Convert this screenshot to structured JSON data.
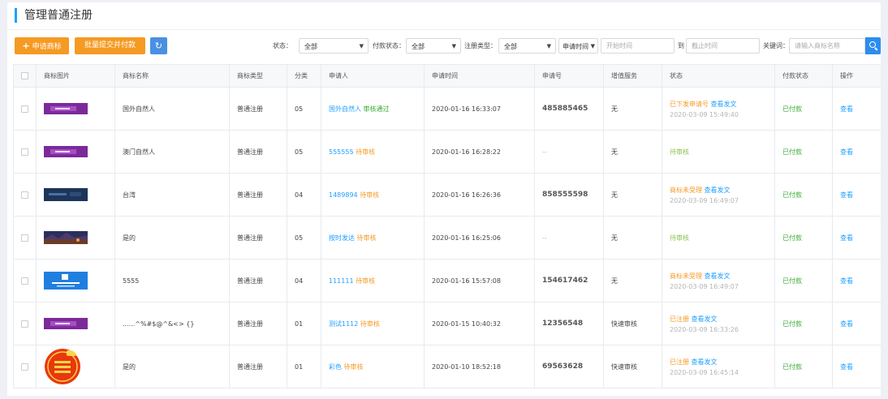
{
  "page": {
    "title": "管理普通注册"
  },
  "toolbar": {
    "apply_label": "申请商标",
    "batch_label": "批量提交并付款",
    "refresh_icon": "refresh-icon",
    "status_label": "状态：",
    "status_value": "全部",
    "pay_status_label": "付款状态：",
    "pay_status_value": "全部",
    "reg_type_label": "注册类型：",
    "reg_type_value": "全部",
    "date_type_value": "申请时间",
    "start_placeholder": "开始时间",
    "to_label": "到",
    "end_placeholder": "截止时间",
    "keyword_label": "关键词：",
    "keyword_placeholder": "请输入商标名称"
  },
  "table": {
    "headers": [
      "商标图片",
      "商标名称",
      "商标类型",
      "分类",
      "申请人",
      "申请时间",
      "申请号",
      "增值服务",
      "状态",
      "付款状态",
      "操作"
    ],
    "rows": [
      {
        "image_icon": "purple-banner-image",
        "name": "国外自然人",
        "type": "普通注册",
        "class": "05",
        "applicant": "国外自然人",
        "applicant_status": "审核通过",
        "time": "2020-01-16 16:33:07",
        "app_no": "485885465",
        "service": "无",
        "status": "已下发申请号",
        "status_link": "查看发文",
        "status_time": "2020-03-09 15:49:40",
        "pay": "已付款",
        "action": "查看"
      },
      {
        "image_icon": "purple-banner-image",
        "name": "澳门自然人",
        "type": "普通注册",
        "class": "05",
        "applicant": "555555",
        "applicant_status": "待审核",
        "time": "2020-01-16 16:28:22",
        "app_no": "--",
        "service": "无",
        "status": "待审核",
        "status_link": "",
        "status_time": "",
        "pay": "已付款",
        "action": "查看"
      },
      {
        "image_icon": "dark-blue-banner-image",
        "name": "台湾",
        "type": "普通注册",
        "class": "04",
        "applicant": "1489894",
        "applicant_status": "待审核",
        "time": "2020-01-16 16:26:36",
        "app_no": "858555598",
        "service": "无",
        "status": "商标未受理",
        "status_link": "查看发文",
        "status_time": "2020-03-09 16:49:07",
        "pay": "已付款",
        "action": "查看"
      },
      {
        "image_icon": "night-city-image",
        "name": "是的",
        "type": "普通注册",
        "class": "05",
        "applicant": "按时发达",
        "applicant_status": "待审核",
        "time": "2020-01-16 16:25:06",
        "app_no": "--",
        "service": "无",
        "status": "待审核",
        "status_link": "",
        "status_time": "",
        "pay": "已付款",
        "action": "查看"
      },
      {
        "image_icon": "blue-banner-image",
        "name": "5555",
        "type": "普通注册",
        "class": "04",
        "applicant": "111111",
        "applicant_status": "待审核",
        "time": "2020-01-16 15:57:08",
        "app_no": "154617462",
        "service": "无",
        "status": "商标未受理",
        "status_link": "查看发文",
        "status_time": "2020-03-09 16:49:07",
        "pay": "已付款",
        "action": "查看"
      },
      {
        "image_icon": "purple-banner-image",
        "name": "......^%#$@^&<> {}",
        "type": "普通注册",
        "class": "01",
        "applicant": "测试1112",
        "applicant_status": "待审核",
        "time": "2020-01-15 10:40:32",
        "app_no": "12356548",
        "service": "快速审核",
        "status": "已注册",
        "status_link": "查看发文",
        "status_time": "2020-03-09 16:33:26",
        "pay": "已付款",
        "action": "查看"
      },
      {
        "image_icon": "congratulations-seal-image",
        "name": "是的",
        "type": "普通注册",
        "class": "01",
        "applicant": "彩色",
        "applicant_status": "待审核",
        "time": "2020-01-10 18:52:18",
        "app_no": "69563628",
        "service": "快速审核",
        "status": "已注册",
        "status_link": "查看发文",
        "status_time": "2020-03-09 16:45:14",
        "pay": "已付款",
        "action": "查看"
      }
    ]
  }
}
